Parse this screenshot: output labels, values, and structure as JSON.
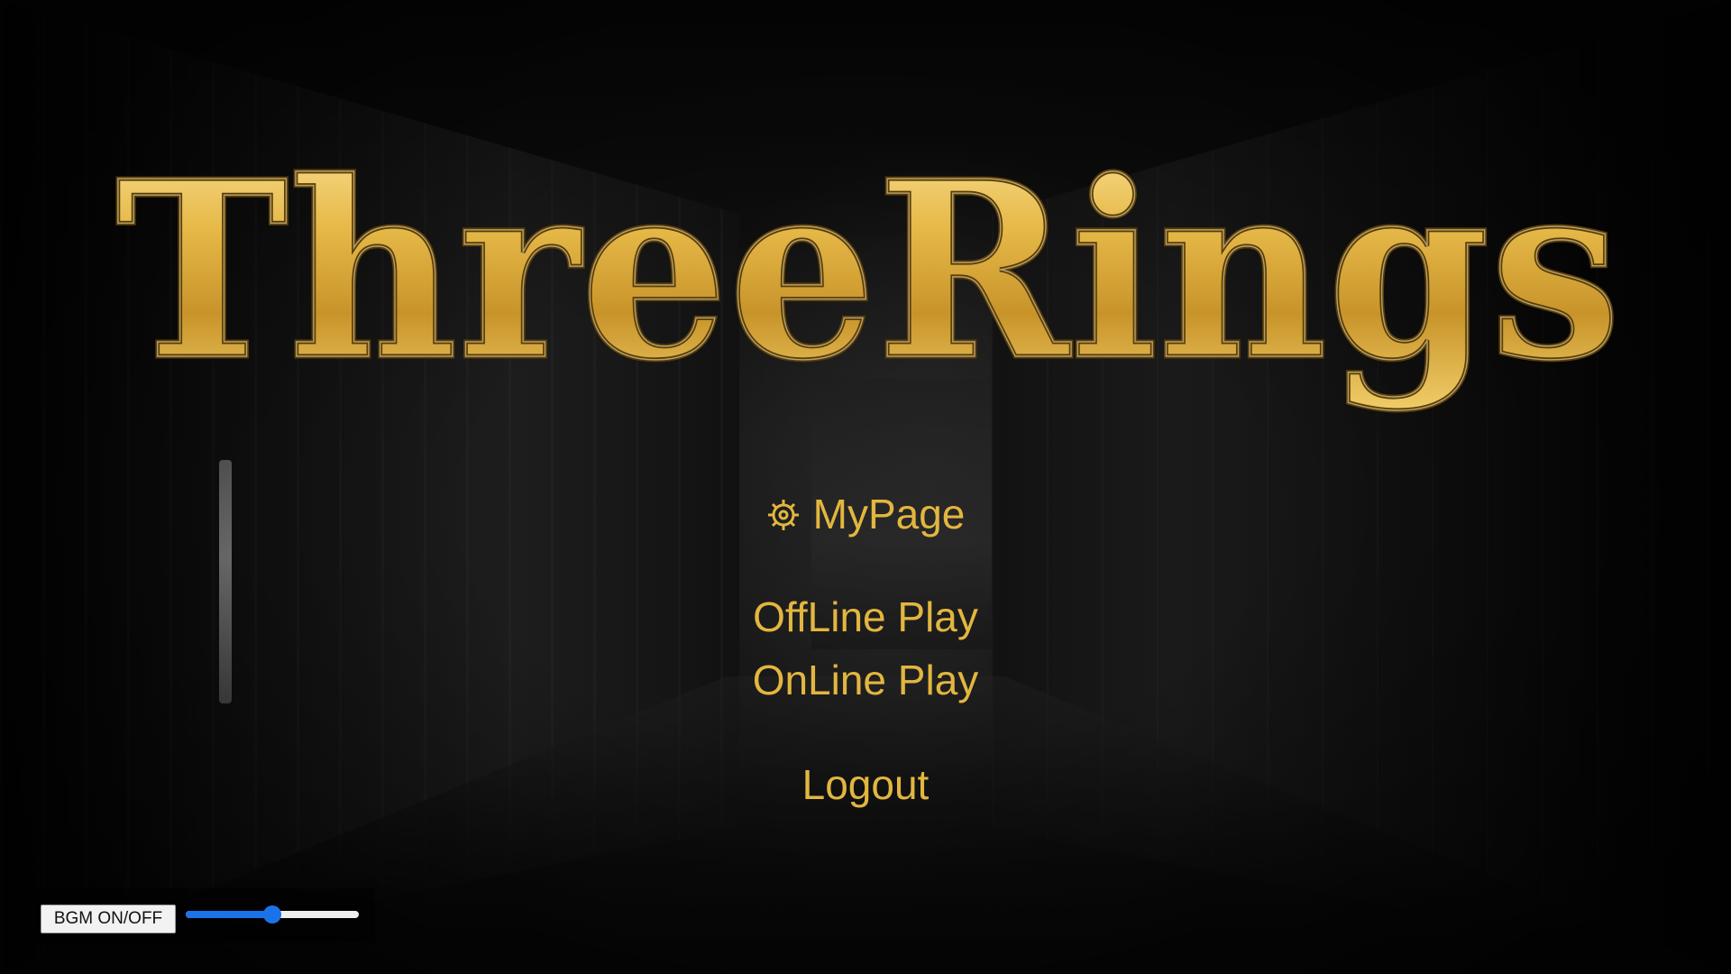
{
  "game": {
    "title": "ThreeRings"
  },
  "menu": {
    "mypage": {
      "label": "MyPage",
      "icon": "gear-icon"
    },
    "offline": {
      "label": "OffLine Play"
    },
    "online": {
      "label": "OnLine Play"
    },
    "logout": {
      "label": "Logout"
    }
  },
  "bgm": {
    "button_label": "BGM ON/OFF",
    "volume": 0.5
  },
  "colors": {
    "menu_text": "#e2b63f",
    "logo_gold_light": "#f6d77a",
    "logo_gold_dark": "#9a6f16",
    "slider_accent": "#1a73e8"
  }
}
